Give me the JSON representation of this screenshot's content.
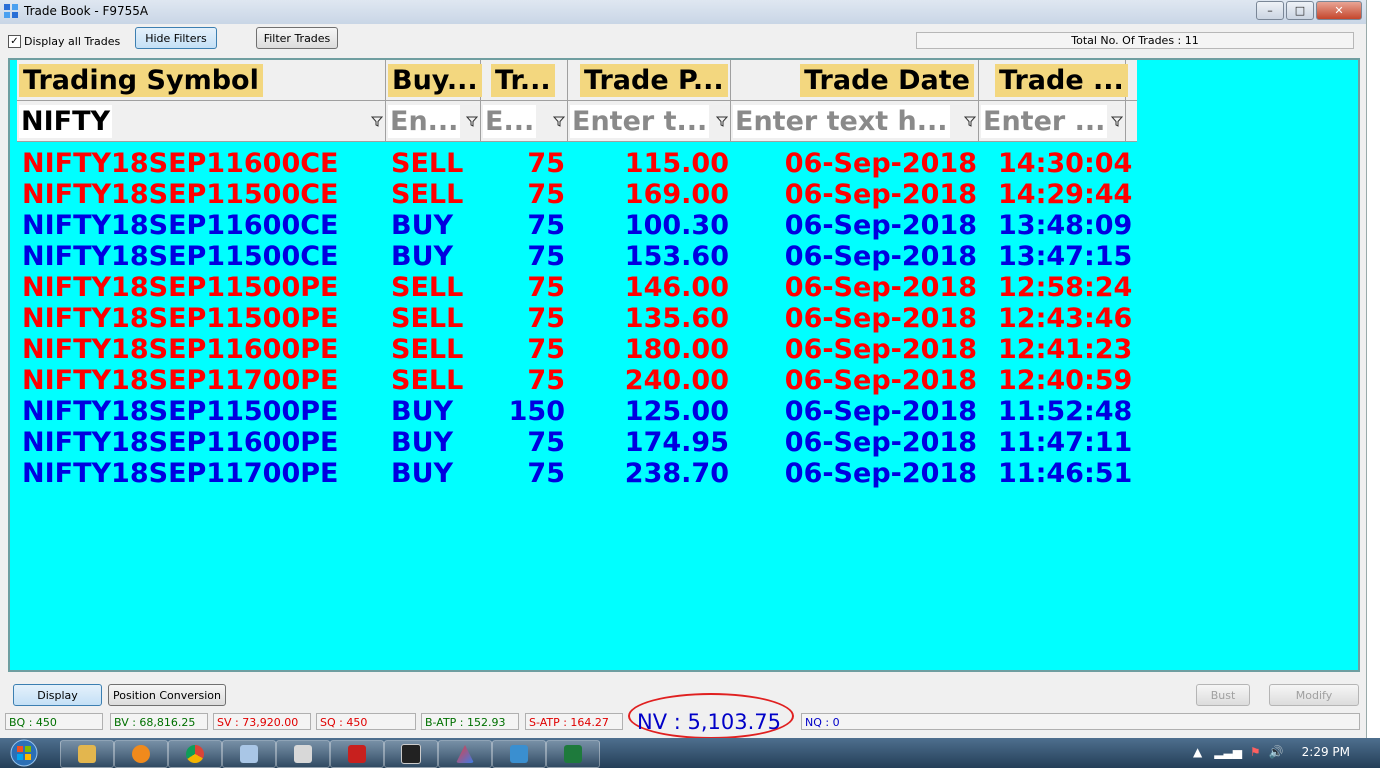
{
  "window": {
    "title": "Trade Book - F9755A",
    "minimize": "–",
    "maximize": "□",
    "close": "✕"
  },
  "toolbar": {
    "display_all_label": "Display all Trades",
    "display_all_checked": "✓",
    "hide_filters": "Hide Filters",
    "filter_trades": "Filter Trades",
    "total": "Total No. Of Trades : 11"
  },
  "grid": {
    "bg_color": "#00ffff",
    "sell_color": "#ff0000",
    "buy_color": "#0000e0",
    "columns": [
      "Trading Symbol",
      "Buy...",
      "Tr...",
      "Trade P...",
      "Trade Date",
      "Trade ..."
    ],
    "filters": [
      "NIFTY",
      "En...",
      "E...",
      "Enter t...",
      "Enter text h...",
      "Enter ..."
    ],
    "rows": [
      {
        "symbol": "NIFTY18SEP11600CE",
        "side": "SELL",
        "qty": "75",
        "price": "115.00",
        "date": "06-Sep-2018",
        "time": "14:30:04"
      },
      {
        "symbol": "NIFTY18SEP11500CE",
        "side": "SELL",
        "qty": "75",
        "price": "169.00",
        "date": "06-Sep-2018",
        "time": "14:29:44"
      },
      {
        "symbol": "NIFTY18SEP11600CE",
        "side": "BUY",
        "qty": "75",
        "price": "100.30",
        "date": "06-Sep-2018",
        "time": "13:48:09"
      },
      {
        "symbol": "NIFTY18SEP11500CE",
        "side": "BUY",
        "qty": "75",
        "price": "153.60",
        "date": "06-Sep-2018",
        "time": "13:47:15"
      },
      {
        "symbol": "NIFTY18SEP11500PE",
        "side": "SELL",
        "qty": "75",
        "price": "146.00",
        "date": "06-Sep-2018",
        "time": "12:58:24"
      },
      {
        "symbol": "NIFTY18SEP11500PE",
        "side": "SELL",
        "qty": "75",
        "price": "135.60",
        "date": "06-Sep-2018",
        "time": "12:43:46"
      },
      {
        "symbol": "NIFTY18SEP11600PE",
        "side": "SELL",
        "qty": "75",
        "price": "180.00",
        "date": "06-Sep-2018",
        "time": "12:41:23"
      },
      {
        "symbol": "NIFTY18SEP11700PE",
        "side": "SELL",
        "qty": "75",
        "price": "240.00",
        "date": "06-Sep-2018",
        "time": "12:40:59"
      },
      {
        "symbol": "NIFTY18SEP11500PE",
        "side": "BUY",
        "qty": "150",
        "price": "125.00",
        "date": "06-Sep-2018",
        "time": "11:52:48"
      },
      {
        "symbol": "NIFTY18SEP11600PE",
        "side": "BUY",
        "qty": "75",
        "price": "174.95",
        "date": "06-Sep-2018",
        "time": "11:47:11"
      },
      {
        "symbol": "NIFTY18SEP11700PE",
        "side": "BUY",
        "qty": "75",
        "price": "238.70",
        "date": "06-Sep-2018",
        "time": "11:46:51"
      }
    ]
  },
  "actions": {
    "display": "Display",
    "position_conversion": "Position Conversion",
    "bust": "Bust",
    "modify": "Modify"
  },
  "status": {
    "bq": "BQ : 450",
    "bv": "BV : 68,816.25",
    "sv": "SV : 73,920.00",
    "sq": "SQ : 450",
    "batp": "B-ATP : 152.93",
    "satp": "S-ATP : 164.27",
    "nv": "NV : 5,103.75",
    "nq": "NQ : 0"
  },
  "taskbar": {
    "apps": [
      "explorer-icon",
      "media-player-icon",
      "chrome-icon",
      "window-icon",
      "calculator-icon",
      "pdf-icon",
      "trading-app-icon",
      "triangle-app-icon",
      "folder-icon",
      "excel-icon"
    ],
    "clock": "2:29 PM"
  }
}
